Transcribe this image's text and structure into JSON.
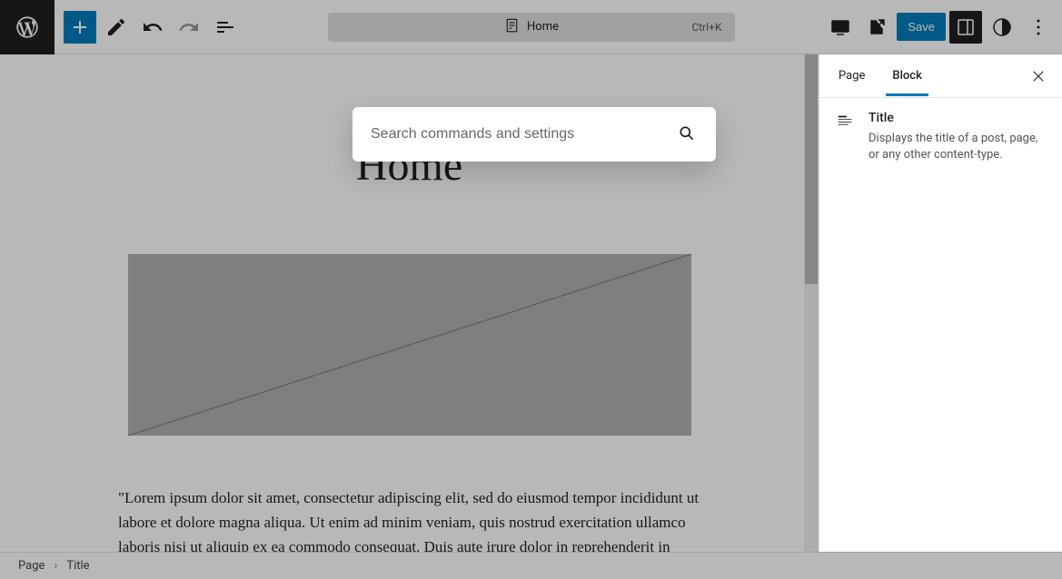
{
  "toolbar": {
    "doc_title": "Home",
    "shortcut": "Ctrl+K",
    "save_label": "Save"
  },
  "command_palette": {
    "placeholder": "Search commands and settings"
  },
  "canvas": {
    "title": "Home",
    "body": "\"Lorem ipsum dolor sit amet, consectetur adipiscing elit, sed do eiusmod tempor incididunt ut labore et dolore magna aliqua. Ut enim ad minim veniam, quis nostrud exercitation ullamco laboris nisi ut aliquip ex ea commodo consequat. Duis aute irure dolor in reprehenderit in voluptate velit esse cillum"
  },
  "sidebar": {
    "tabs": {
      "page": "Page",
      "block": "Block"
    },
    "block": {
      "title": "Title",
      "description": "Displays the title of a post, page, or any other content-type."
    }
  },
  "breadcrumb": {
    "root": "Page",
    "current": "Title"
  }
}
